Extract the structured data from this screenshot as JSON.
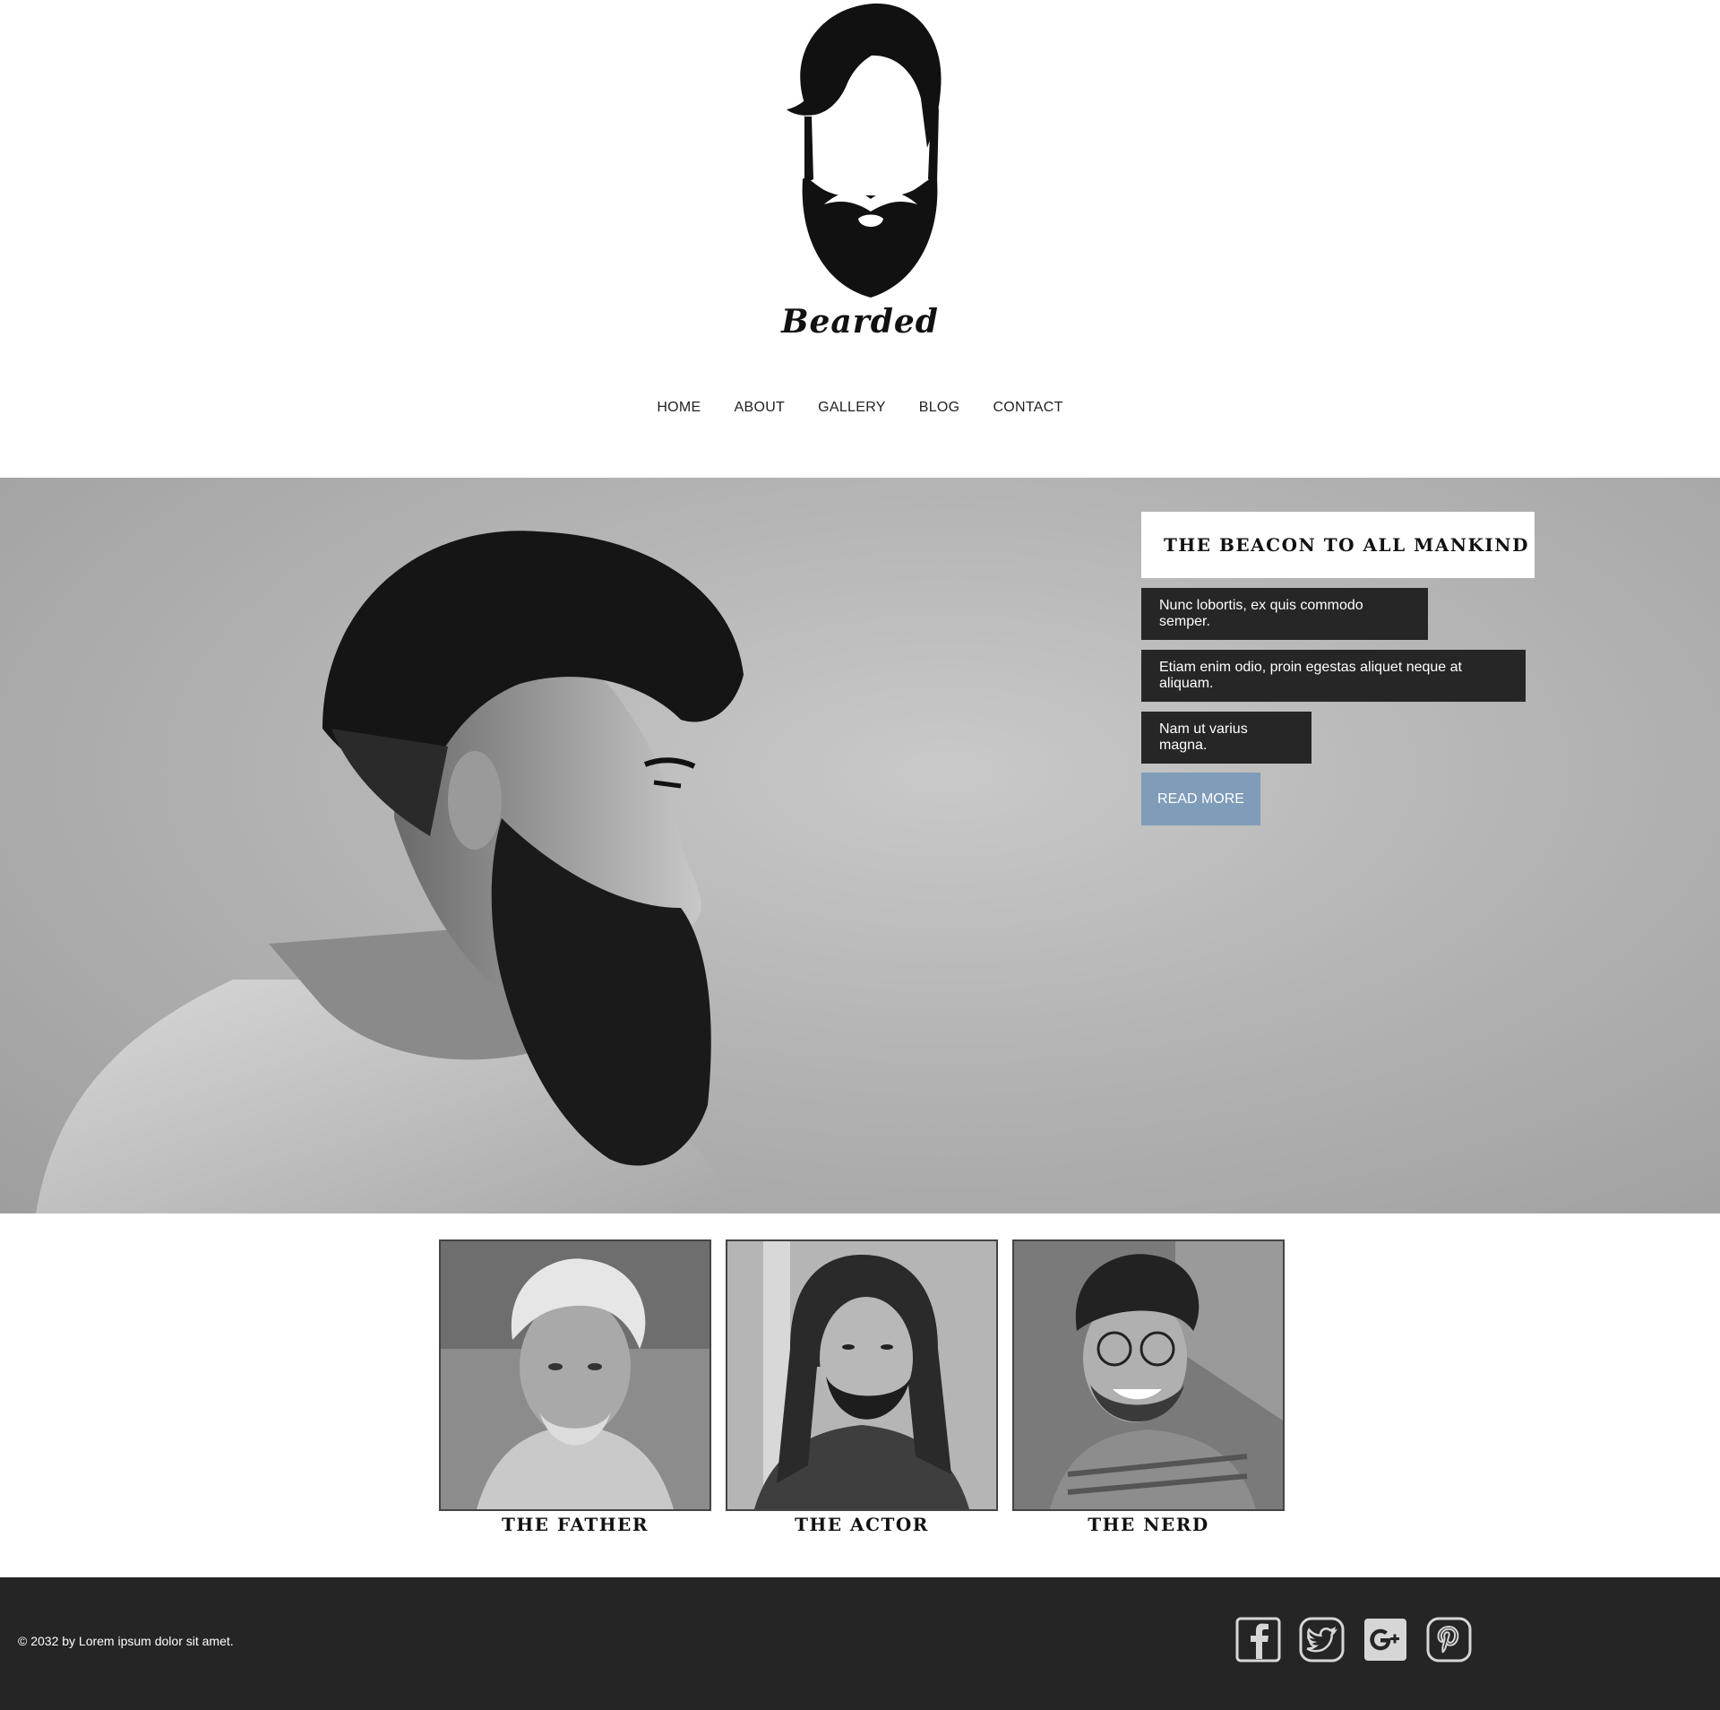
{
  "brand": {
    "name": "Bearded"
  },
  "nav": {
    "items": [
      "HOME",
      "ABOUT",
      "GALLERY",
      "BLOG",
      "CONTACT"
    ]
  },
  "hero": {
    "title": "THE BEACON TO ALL MANKIND",
    "lines": [
      "Nunc lobortis, ex quis commodo semper.",
      "Etiam enim odio, proin egestas aliquet neque at aliquam.",
      "Nam ut varius magna."
    ],
    "cta_label": "READ MORE",
    "cta_color": "#7f9cb9"
  },
  "portraits": [
    {
      "caption": "THE FATHER"
    },
    {
      "caption": "THE ACTOR"
    },
    {
      "caption": "THE NERD"
    }
  ],
  "footer": {
    "copyright": "© 2032 by Lorem ipsum dolor sit amet.",
    "socials": [
      "facebook-icon",
      "twitter-icon",
      "google-plus-icon",
      "pinterest-icon"
    ]
  },
  "colors": {
    "footer_bg": "#252525",
    "text_box_bg": "#262627",
    "accent": "#7f9cb9"
  }
}
